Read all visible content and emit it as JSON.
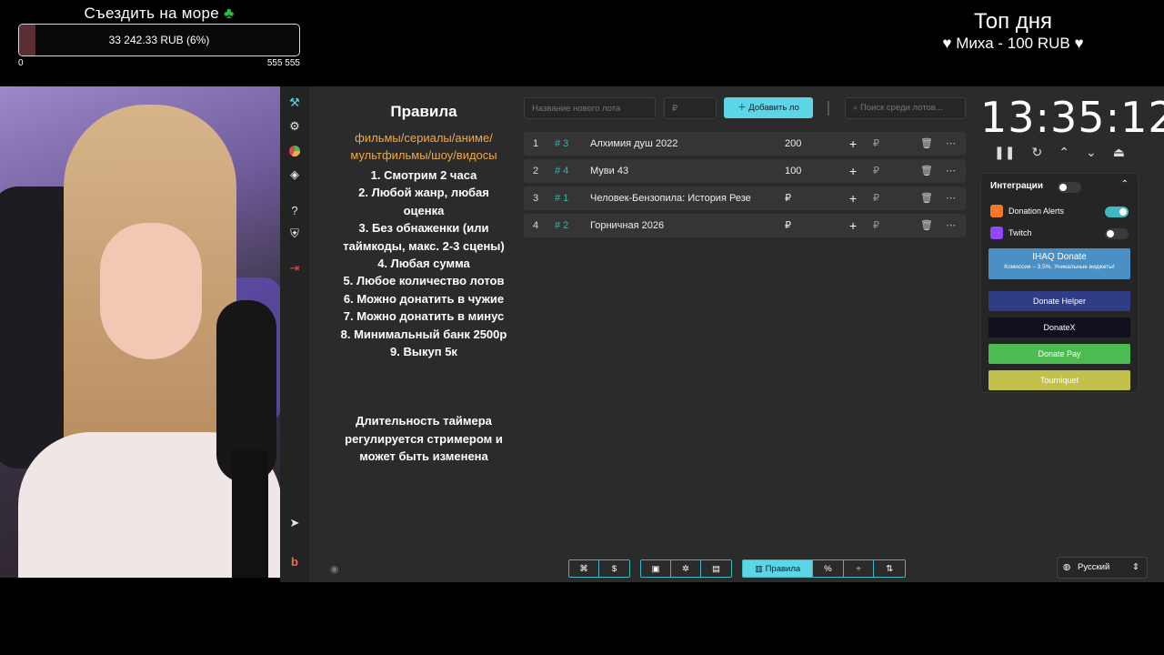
{
  "goal": {
    "title": "Съездить на море",
    "icon": "clover-icon",
    "amount": "33 242.33 RUB (6%)",
    "progress_percent": 6,
    "scale_min": "0",
    "scale_max": "555 555"
  },
  "top_day": {
    "title": "Топ дня",
    "line": "Миха - 100 RUB"
  },
  "sidebar": {
    "icons": [
      "gavel-icon",
      "gear-icon",
      "pie-chart-icon",
      "layers-icon",
      "help-icon",
      "shield-icon",
      "logout-icon",
      "telegram-icon",
      "boosty-icon"
    ]
  },
  "rules": {
    "title": "Правила",
    "categories_1": "фильмы/сериалы/аниме/",
    "categories_2": "мультфильмы/шоу/видосы",
    "items": [
      "1. Смотрим 2 часа",
      "2. Любой жанр, любая",
      "оценка",
      "3. Без обнаженки (или",
      "таймкоды, макс. 2-3 сцены)",
      "4. Любая сумма",
      "5. Любое количество лотов",
      "6. Можно донатить в чужие",
      "7. Можно донатить в минус",
      "8. Минимальный банк 2500р",
      "9. Выкуп 5к"
    ],
    "note_1": "Длительность таймера",
    "note_2": "регулируется стримером и",
    "note_3": "может быть изменена"
  },
  "toolbar": {
    "new_lot_placeholder": "Название нового лота",
    "amount_placeholder": "₽",
    "add_label": "Добавить ло",
    "search_placeholder": "Поиск среди лотов..."
  },
  "lots": [
    {
      "n": "1",
      "tag": "# 3",
      "name": "Алхимия душ 2022",
      "amount": "200",
      "rub": "₽"
    },
    {
      "n": "2",
      "tag": "# 4",
      "name": "Муви 43",
      "amount": "100",
      "rub": "₽"
    },
    {
      "n": "3",
      "tag": "# 1",
      "name": "Человек-Бензопила: История Резе",
      "amount": "₽",
      "rub": "₽"
    },
    {
      "n": "4",
      "tag": "# 2",
      "name": "Горничная 2026",
      "amount": "₽",
      "rub": "₽"
    }
  ],
  "timer": {
    "value": "13:35:12"
  },
  "integrations": {
    "title": "Интеграции",
    "donation_alerts": "Donation Alerts",
    "twitch": "Twitch",
    "ihaq_title": "IHAQ Donate",
    "ihaq_sub": "Комиссия – 3,5%. Уникальные виджеты!",
    "donate_helper": "Donate Helper",
    "donatex": "DonateX",
    "donate_pay": "Donate Pay",
    "tourniquet": "Tourniquet"
  },
  "bottombar": {
    "rules_label": "Правила",
    "dollar": "$",
    "percent": "%"
  },
  "language": "Русский",
  "colors": {
    "accent": "#5cd6e6",
    "rules_categories": "#f0a949",
    "tag": "#3fb2a5",
    "donate_pay": "#4cbc52",
    "tourniquet": "#c2c24a",
    "donate_helper": "#2f3c86",
    "ihaq": "#4a90c4"
  }
}
